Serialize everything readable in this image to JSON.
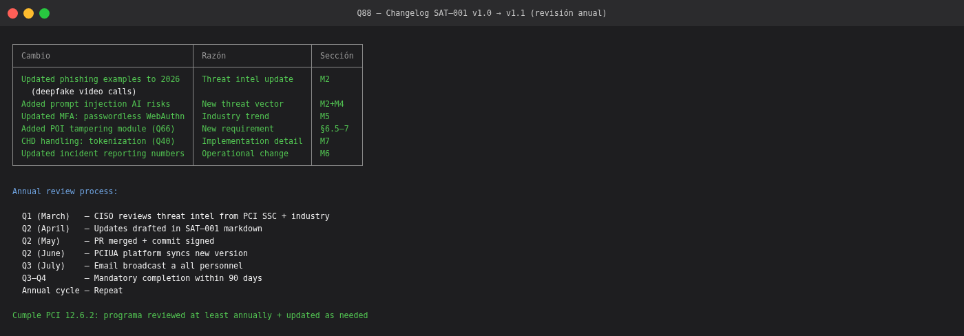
{
  "window": {
    "title": "Q88 — Changelog SAT–001 v1.0 → v1.1 (revisión anual)"
  },
  "table": {
    "columns": [
      "Cambio",
      "Razón",
      "Sección"
    ],
    "rows": [
      {
        "change": "Updated phishing examples to 2026",
        "note": "(deepfake video calls)",
        "reason": "Threat intel update",
        "section": "M2"
      },
      {
        "change": "Added prompt injection AI risks",
        "reason": "New threat vector",
        "section": "M2+M4"
      },
      {
        "change": "Updated MFA: passwordless WebAuthn",
        "reason": "Industry trend",
        "section": "M5"
      },
      {
        "change": "Added POI tampering module (Q66)",
        "reason": "New requirement",
        "section": "§6.5–7"
      },
      {
        "change": "CHD handling: tokenization (Q40)",
        "reason": "Implementation detail",
        "section": "M7"
      },
      {
        "change": "Updated incident reporting numbers",
        "reason": "Operational change",
        "section": "M6"
      }
    ]
  },
  "process": {
    "heading": "Annual review process:",
    "lines": [
      "Q1 (March)   — CISO reviews threat intel from PCI SSC + industry",
      "Q2 (April)   — Updates drafted in SAT–001 markdown",
      "Q2 (May)     — PR merged + commit signed",
      "Q2 (June)    — PCIUA platform syncs new version",
      "Q3 (July)    — Email broadcast a all personnel",
      "Q3–Q4        — Mandatory completion within 90 days",
      "Annual cycle — Repeat"
    ]
  },
  "footer": "Cumple PCI 12.6.2: programa reviewed at least annually + updated as needed"
}
